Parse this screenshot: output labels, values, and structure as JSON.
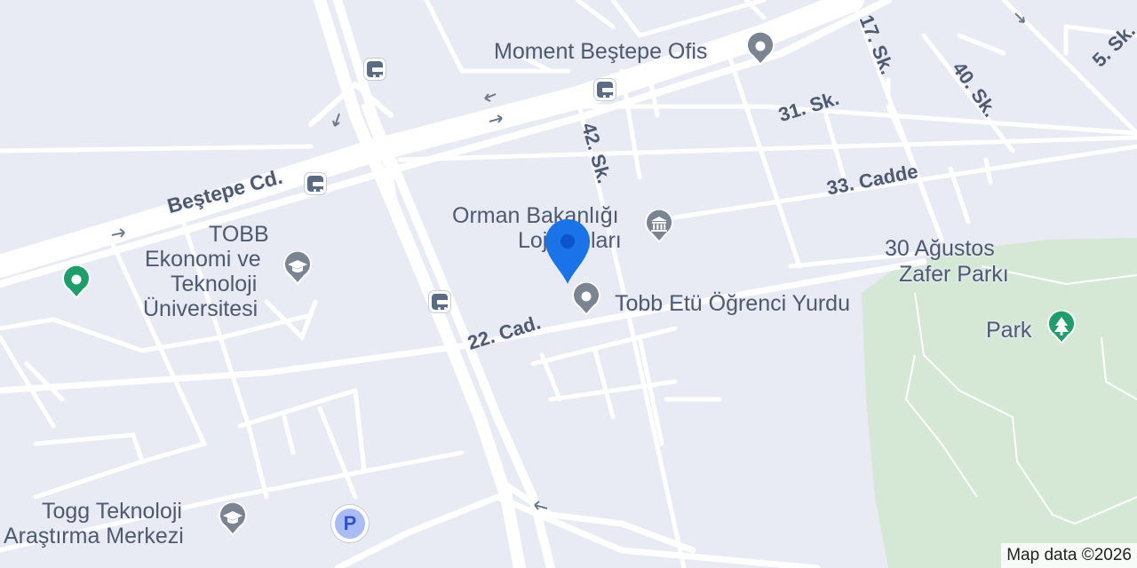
{
  "map": {
    "places": {
      "moment": "Moment Beştepe Ofis",
      "orman_l1": "Orman Bakanlığı",
      "orman_l2": "Lojmanları",
      "tobb_l1": "TOBB",
      "tobb_l2": "Ekonomi ve",
      "tobb_l3": "Teknoloji",
      "tobb_l4": "Üniversitesi",
      "yurdu": "Tobb Etü Öğrenci Yurdu",
      "zafer_l1": "30 Ağustos",
      "zafer_l2": "Zafer Parkı",
      "park": "Park",
      "togg_l1": "Togg Teknoloji",
      "togg_l2": "Araştırma Merkezi"
    },
    "streets": {
      "bestepe": "Beştepe Cd.",
      "sk42": "42. Sk.",
      "sk31": "31. Sk.",
      "sk17": "17. Sk.",
      "sk40": "40. Sk.",
      "sk5": "5. Sk.",
      "cadde33": "33. Cadde",
      "cad22": "22. Cad."
    },
    "icons": {
      "parking_letter": "P"
    },
    "attribution": "Map data ©2026",
    "colors": {
      "background": "#e8eaf4",
      "road": "#ffffff",
      "park": "#d5e8d6",
      "pin_gray": "#7a8591",
      "pin_green": "#1e9e6a",
      "selected_pin": "#1a73e8",
      "label": "#4e5a6e"
    }
  }
}
